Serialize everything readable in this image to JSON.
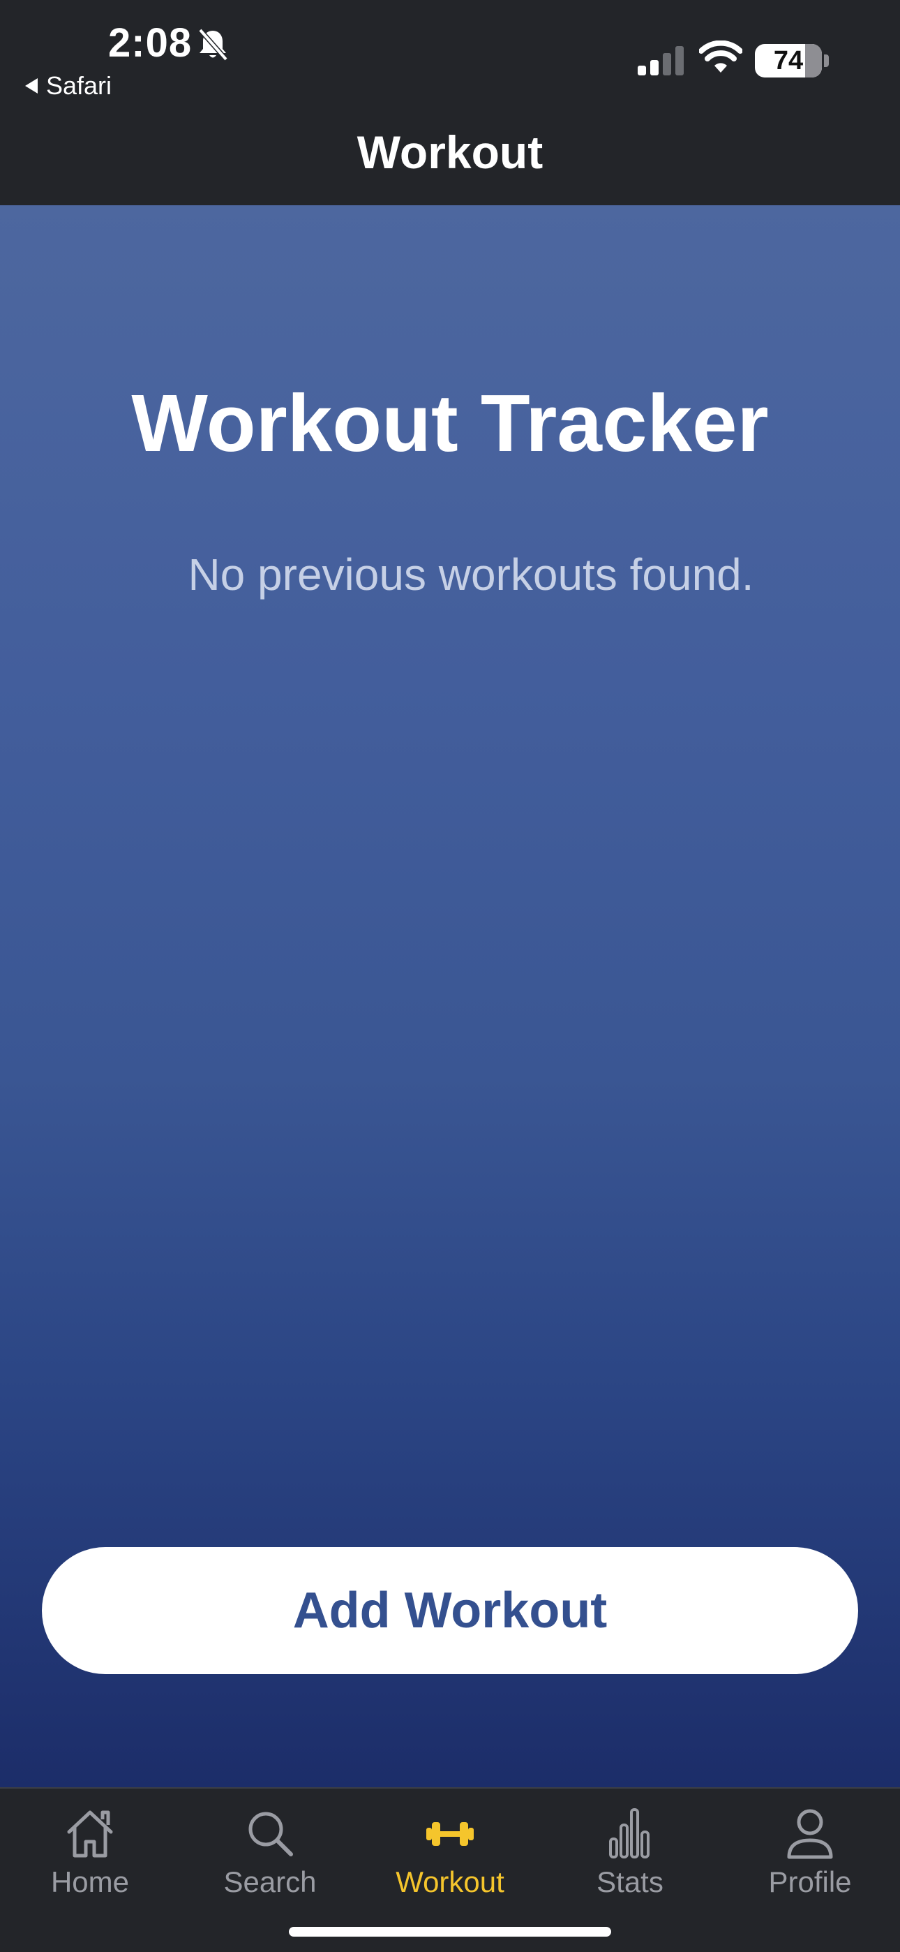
{
  "status_bar": {
    "time": "2:08",
    "back_app": "Safari",
    "battery": "74"
  },
  "nav": {
    "title": "Workout"
  },
  "main": {
    "title": "Workout Tracker",
    "empty_message": "No previous workouts found.",
    "add_button_label": "Add Workout"
  },
  "tabs": [
    {
      "label": "Home",
      "icon": "home-icon"
    },
    {
      "label": "Search",
      "icon": "search-icon"
    },
    {
      "label": "Workout",
      "icon": "dumbbell-icon",
      "active": true
    },
    {
      "label": "Stats",
      "icon": "bar-chart-icon"
    },
    {
      "label": "Profile",
      "icon": "person-icon"
    }
  ],
  "colors": {
    "active_tab": "#f5c52c",
    "inactive_tab": "#9a9ca3",
    "bar_background": "#232529",
    "button_text": "#34508f"
  }
}
